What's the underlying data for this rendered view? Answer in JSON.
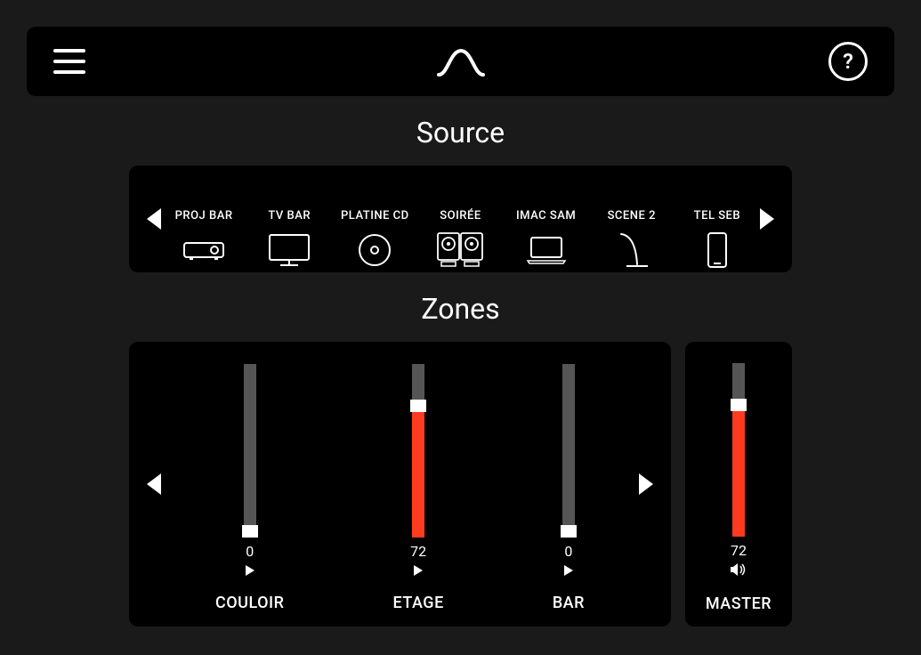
{
  "header": {
    "help": "?"
  },
  "source": {
    "title": "Source",
    "items": [
      {
        "label": "PROJ BAR",
        "icon": "projector"
      },
      {
        "label": "TV BAR",
        "icon": "tv"
      },
      {
        "label": "PLATINE CD",
        "icon": "cd"
      },
      {
        "label": "SOIRÉE",
        "icon": "turntables"
      },
      {
        "label": "IMAC SAM",
        "icon": "laptop"
      },
      {
        "label": "SCENE 2",
        "icon": "mic"
      },
      {
        "label": "TEL SEB",
        "icon": "phone"
      }
    ]
  },
  "zones": {
    "title": "Zones",
    "items": [
      {
        "name": "COULOIR",
        "value": 0
      },
      {
        "name": "ETAGE",
        "value": 72
      },
      {
        "name": "BAR",
        "value": 0
      }
    ],
    "master": {
      "name": "MASTER",
      "value": 72
    }
  }
}
